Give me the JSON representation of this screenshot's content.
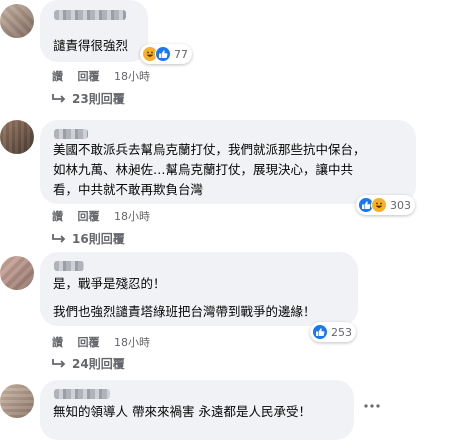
{
  "comments": [
    {
      "text_lines": [
        "譴責得很強烈"
      ],
      "reactions": {
        "icons": [
          "haha-icon",
          "like-icon"
        ],
        "count": "77"
      },
      "actions": {
        "like": "讚",
        "reply": "回覆",
        "time": "18小時"
      },
      "replies": "23則回覆"
    },
    {
      "text_lines": [
        "美國不敢派兵去幫烏克蘭打仗，我們就派那些抗中保台，",
        "如林九萬、林昶佐…幫烏克蘭打仗，展現決心，讓中共",
        "看，中共就不敢再欺負台灣"
      ],
      "reactions": {
        "icons": [
          "like-icon",
          "haha-icon"
        ],
        "count": "303"
      },
      "actions": {
        "like": "讚",
        "reply": "回覆",
        "time": "18小時"
      },
      "replies": "16則回覆"
    },
    {
      "text_lines": [
        "是，戰爭是殘忍的！",
        "",
        "我們也強烈譴責塔綠班把台灣帶到戰爭的邊緣！"
      ],
      "reactions": {
        "icons": [
          "like-icon"
        ],
        "count": "253"
      },
      "actions": {
        "like": "讚",
        "reply": "回覆",
        "time": "18小時"
      },
      "replies": "24則回覆"
    },
    {
      "text_lines": [
        "無知的領導人 帶來來禍害 永遠都是人民承受！"
      ]
    }
  ],
  "colors": {
    "bubble": "#f0f2f5",
    "like_blue": "#1877f2",
    "haha_yellow": "#f7b125",
    "secondary_text": "#65676b"
  }
}
